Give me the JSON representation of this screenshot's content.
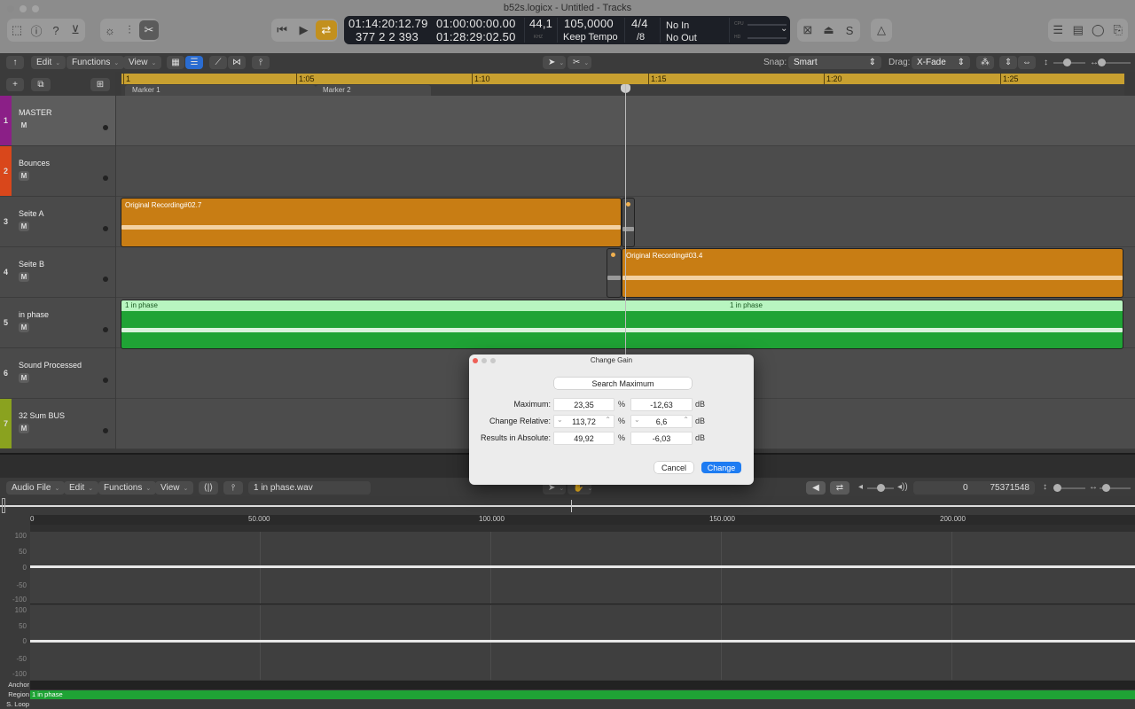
{
  "window": {
    "title": "b52s.logicx - Untitled - Tracks"
  },
  "control_bar": {
    "left_icons": [
      "library-icon",
      "info-icon",
      "help-icon",
      "inbox-icon"
    ],
    "view_icons": [
      "smart-controls-icon",
      "mixer-icon",
      "editors-icon"
    ],
    "transport": [
      "go-to-beginning-icon",
      "play-icon",
      "cycle-icon"
    ],
    "lcd": {
      "smpte": "01:14:20:12.79",
      "bars": "377  2  2  393",
      "locator_start": "01:00:00:00.00",
      "locator_end": "01:28:29:02.50",
      "sample_rate": "44,1",
      "sample_rate_unit": "KHZ",
      "tempo": "105,0000",
      "tempo_mode": "Keep Tempo",
      "time_sig": "4/4",
      "division": "/8",
      "input": "No In",
      "output": "No Out",
      "cpu_label": "CPU",
      "hd_label": "HD"
    },
    "right_icons": [
      "list-editors-icon",
      "notepad-icon",
      "loop-browser-icon",
      "browser-icon"
    ],
    "mid_icons": [
      "low-latency-icon",
      "count-in-icon",
      "solo-icon",
      "metronome-icon"
    ]
  },
  "tracks_toolbar": {
    "edit": "Edit",
    "functions": "Functions",
    "view": "View",
    "snap_label": "Snap:",
    "snap_value": "Smart",
    "drag_label": "Drag:",
    "drag_value": "X-Fade"
  },
  "ruler": {
    "ticks": [
      "1",
      "1:05",
      "1:10",
      "1:15",
      "1:20",
      "1:25"
    ],
    "markers": [
      "Marker 1",
      "Marker 2"
    ]
  },
  "tracks": [
    {
      "num": "1",
      "name": "MASTER",
      "mute": "M",
      "color": "#8b1f87"
    },
    {
      "num": "2",
      "name": "Bounces",
      "mute": "M",
      "color": "#d9471b"
    },
    {
      "num": "3",
      "name": "Seite A",
      "mute": "M",
      "color": "#4a4a4a"
    },
    {
      "num": "4",
      "name": "Seite B",
      "mute": "M",
      "color": "#4a4a4a"
    },
    {
      "num": "5",
      "name": "in phase",
      "mute": "M",
      "color": "#4a4a4a"
    },
    {
      "num": "6",
      "name": "Sound Processed",
      "mute": "M",
      "color": "#4a4a4a"
    },
    {
      "num": "7",
      "name": "32 Sum BUS",
      "mute": "M",
      "color": "#8aa21f"
    }
  ],
  "regions": {
    "seite_a": "Original Recording#02.7",
    "seite_b": "Original Recording#03.4",
    "in_phase_1": "1 in phase",
    "in_phase_2": "1 in phase"
  },
  "dialog": {
    "title": "Change Gain",
    "search_button": "Search Maximum",
    "rows": [
      {
        "label": "Maximum:",
        "pct": "23,35",
        "db": "-12,63"
      },
      {
        "label": "Change Relative:",
        "pct": "113,72",
        "db": "6,6"
      },
      {
        "label": "Results in Absolute:",
        "pct": "49,92",
        "db": "-6,03"
      }
    ],
    "pct_unit": "%",
    "db_unit": "dB",
    "cancel": "Cancel",
    "change": "Change"
  },
  "editor": {
    "menus": [
      "Audio File",
      "Edit",
      "Functions",
      "View"
    ],
    "filename": "1 in phase.wav",
    "start_sample": "0",
    "end_sample": "75371548",
    "sample_ruler": [
      "0",
      "50.000",
      "100.000",
      "150.000",
      "200.000"
    ],
    "y_labels": [
      "100",
      "50",
      "0",
      "-50",
      "-100"
    ],
    "footer": {
      "anchor": "Anchor",
      "region": "Region",
      "region_name": "1 in phase",
      "sloop": "S. Loop"
    }
  }
}
